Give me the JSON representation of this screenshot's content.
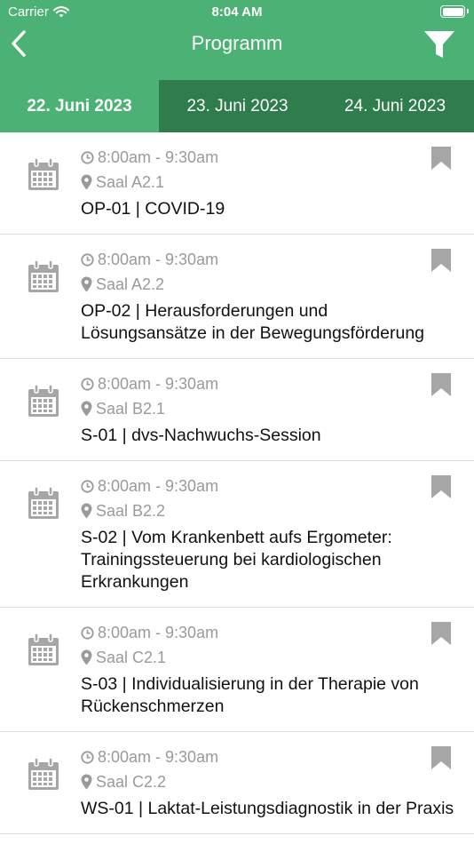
{
  "status": {
    "carrier": "Carrier",
    "time": "8:04 AM"
  },
  "nav": {
    "title": "Programm",
    "back_icon": "chevron-left-icon",
    "filter_icon": "filter-icon"
  },
  "tabs": [
    {
      "label": "22. Juni 2023",
      "active": true
    },
    {
      "label": "23. Juni 2023",
      "active": false
    },
    {
      "label": "24. Juni 2023",
      "active": false
    }
  ],
  "sessions": [
    {
      "time": "8:00am - 9:30am",
      "room": "Saal A2.1",
      "title": "OP-01 | COVID-19"
    },
    {
      "time": "8:00am - 9:30am",
      "room": "Saal A2.2",
      "title": "OP-02 | Herausforderungen und Lösungsansätze in der Bewegungsförderung"
    },
    {
      "time": "8:00am - 9:30am",
      "room": "Saal B2.1",
      "title": "S-01 | dvs-Nachwuchs-Session"
    },
    {
      "time": "8:00am - 9:30am",
      "room": "Saal B2.2",
      "title": "S-02 | Vom Krankenbett aufs Ergometer: Trainingssteuerung bei kardiologischen Erkrankungen"
    },
    {
      "time": "8:00am - 9:30am",
      "room": "Saal C2.1",
      "title": "S-03 | Individualisierung in der Therapie von Rückenschmerzen"
    },
    {
      "time": "8:00am - 9:30am",
      "room": "Saal C2.2",
      "title": "WS-01 | Laktat-Leistungsdiagnostik in der Praxis"
    }
  ],
  "colors": {
    "primary": "#4bb174",
    "tab_inactive": "#2f7c4d",
    "meta_gray": "#9a9a9a",
    "icon_gray": "#a6a6a6"
  }
}
